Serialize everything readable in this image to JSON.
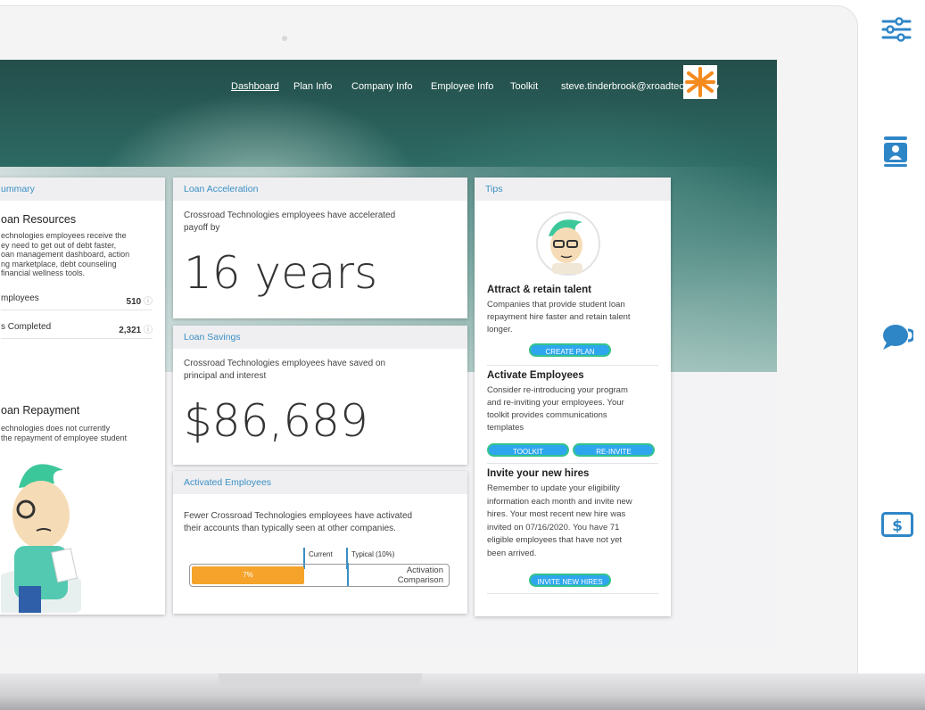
{
  "nav": {
    "items": [
      "Dashboard",
      "Plan Info",
      "Company Info",
      "Employee Info",
      "Toolkit"
    ],
    "user_email": "steve.tinderbrook@xroadtech.com"
  },
  "summary_card": {
    "header": "ummary",
    "section1_title": "oan Resources",
    "section1_text": [
      "echnologies employees receive the",
      "ey need to get out of debt faster,",
      "oan management dashboard, action",
      "ng marketplace, debt counseling",
      " financial wellness tools."
    ],
    "stats": [
      {
        "label": "mployees",
        "value": "510"
      },
      {
        "label": "s Completed",
        "value": "2,321"
      }
    ],
    "section2_title": "oan Repayment",
    "section2_text": [
      "echnologies does not currently",
      "the repayment of employee student"
    ]
  },
  "loan_acceleration": {
    "header": "Loan Acceleration",
    "text": [
      "Crossroad Technologies employees have accelerated",
      "payoff by"
    ],
    "value": "16 years"
  },
  "loan_savings": {
    "header": "Loan Savings",
    "text": [
      "Crossroad Technologies employees have saved on",
      "principal and interest"
    ],
    "value": "$86,689"
  },
  "activated": {
    "header": "Activated Employees",
    "text": [
      "Fewer Crossroad Technologies employees have activated",
      "their accounts than typically seen at other companies."
    ],
    "current_label": "Current",
    "typical_label": "Typical (10%)",
    "bar_value_label": "7%",
    "bar_fraction": 0.07,
    "typical_fraction": 0.1,
    "legend": [
      "Activation",
      "Comparison"
    ]
  },
  "tips": {
    "header": "Tips",
    "items": [
      {
        "title": "Attract & retain talent",
        "body": [
          "Companies that provide student loan",
          "repayment hire faster and retain talent",
          "longer."
        ],
        "buttons": [
          "CREATE PLAN"
        ]
      },
      {
        "title": "Activate Employees",
        "body": [
          "Consider re-introducing your program",
          "and re-inviting your employees. Your",
          "toolkit provides communications",
          "templates"
        ],
        "buttons": [
          "TOOLKIT",
          "RE-INVITE"
        ]
      },
      {
        "title": "Invite your new hires",
        "body": [
          "Remember to update your eligibility",
          "information each month and invite new",
          "hires. Your most recent new hire was",
          "invited on 07/16/2020. You have 71",
          "eligible employees that have not yet",
          "been arrived."
        ],
        "buttons": [
          "INVITE NEW HIRES"
        ]
      }
    ]
  },
  "side_icons": [
    "sliders-icon",
    "id-card-icon",
    "chat-bubbles-icon",
    "dollar-bill-icon"
  ],
  "colors": {
    "accent": "#3a8fc4",
    "progress": "#f5a32b",
    "button": "#2ea6ee",
    "button_border": "#33c38b",
    "logo": "#f58a1f"
  }
}
